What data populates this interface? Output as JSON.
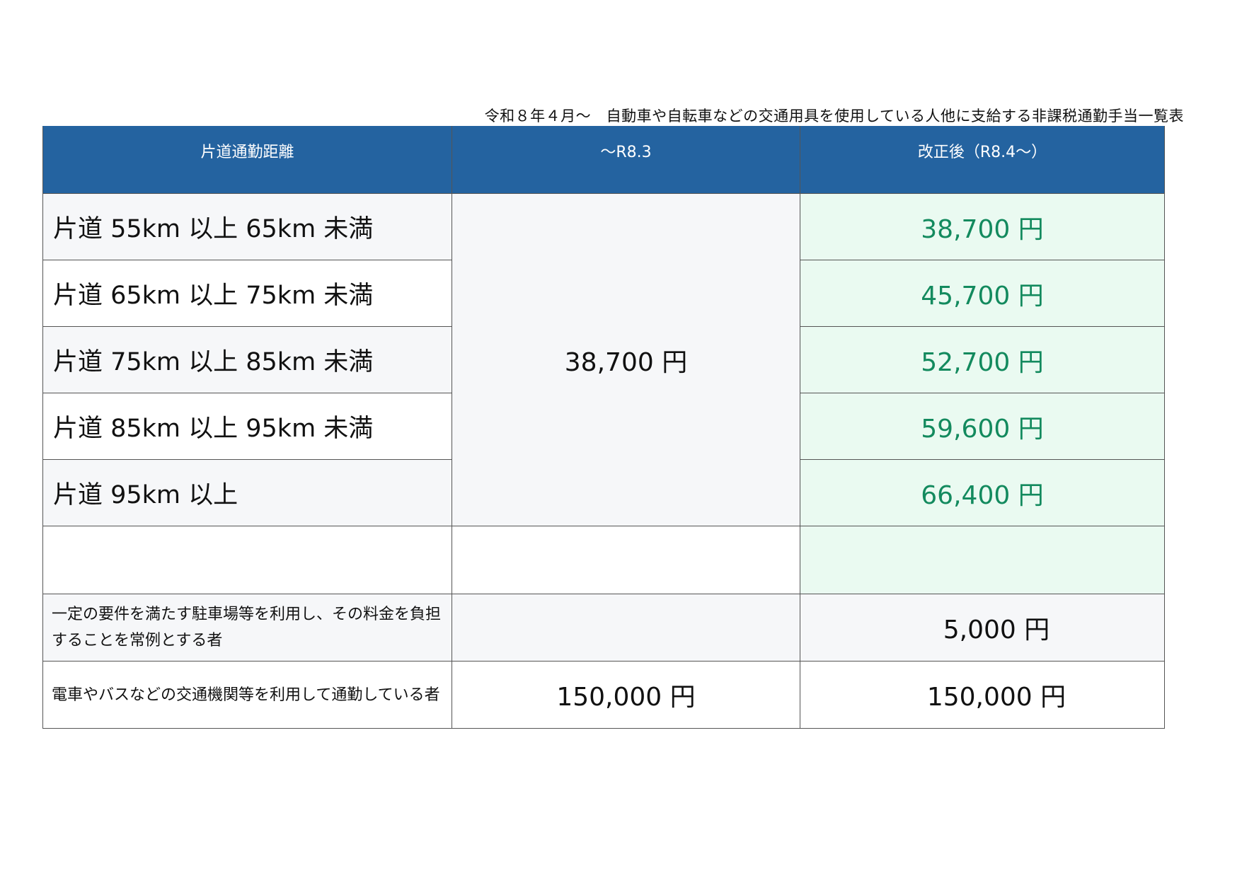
{
  "title": "令和８年４月～　自動車や自転車などの交通用具を使用している人他に支給する非課税通勤手当一覧表",
  "headers": {
    "col1": "片道通勤距離",
    "col2": "～R8.3",
    "col3": "改正後（R8.4～）"
  },
  "rows": [
    {
      "distance": "片道 55km 以上 65km 未満",
      "revised": "38,700 円"
    },
    {
      "distance": "片道 65km 以上 75km 未満",
      "revised": "45,700 円"
    },
    {
      "distance": "片道 75km 以上 85km 未満",
      "revised": "52,700 円"
    },
    {
      "distance": "片道 85km 以上 95km 未満",
      "revised": "59,600 円"
    },
    {
      "distance": "片道 95km 以上",
      "revised": "66,400 円"
    }
  ],
  "merged_old": "38,700 円",
  "parking": {
    "label": "一定の要件を満たす駐車場等を利用し、その料金を負担することを常例とする者",
    "old": "",
    "revised": "5,000 円"
  },
  "transit": {
    "label": "電車やバスなどの交通機関等を利用して通勤している者",
    "old": "150,000 円",
    "revised": "150,000 円"
  }
}
